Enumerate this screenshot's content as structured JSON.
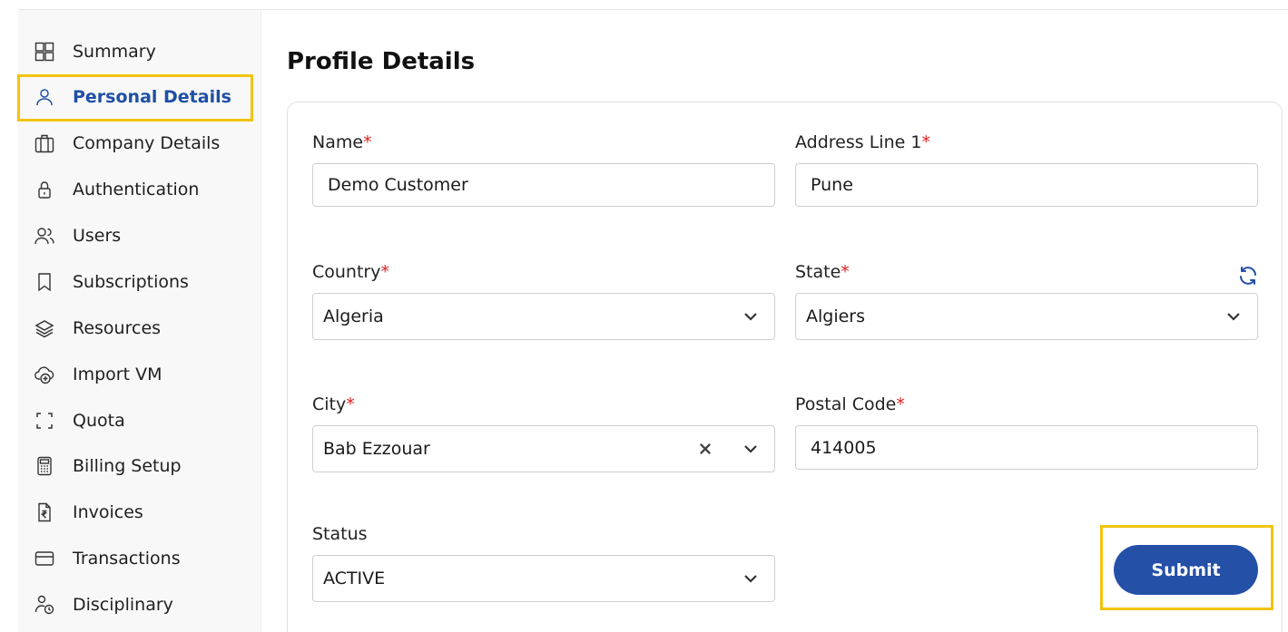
{
  "sidebar": {
    "items": [
      {
        "label": "Summary",
        "icon": "grid-icon"
      },
      {
        "label": "Personal Details",
        "icon": "user-icon",
        "active": true
      },
      {
        "label": "Company Details",
        "icon": "briefcase-icon"
      },
      {
        "label": "Authentication",
        "icon": "lock-icon"
      },
      {
        "label": "Users",
        "icon": "users-icon"
      },
      {
        "label": "Subscriptions",
        "icon": "bookmark-icon"
      },
      {
        "label": "Resources",
        "icon": "layers-icon"
      },
      {
        "label": "Import VM",
        "icon": "cloud-plus-icon"
      },
      {
        "label": "Quota",
        "icon": "frame-corners-icon"
      },
      {
        "label": "Billing Setup",
        "icon": "calculator-icon"
      },
      {
        "label": "Invoices",
        "icon": "rupee-document-icon"
      },
      {
        "label": "Transactions",
        "icon": "card-icon"
      },
      {
        "label": "Disciplinary",
        "icon": "user-clock-icon"
      }
    ]
  },
  "main": {
    "title": "Profile Details",
    "form": {
      "required_mark": "*",
      "name": {
        "label": "Name",
        "value": "Demo Customer"
      },
      "address_line_1": {
        "label": "Address Line 1",
        "value": "Pune"
      },
      "country": {
        "label": "Country",
        "value": "Algeria"
      },
      "state": {
        "label": "State",
        "value": "Algiers"
      },
      "city": {
        "label": "City",
        "value": "Bab Ezzouar"
      },
      "postal_code": {
        "label": "Postal Code",
        "value": "414005"
      },
      "status": {
        "label": "Status",
        "value": "ACTIVE"
      },
      "submit_label": "Submit"
    }
  },
  "colors": {
    "accent": "#2450a8",
    "active_text": "#1e4fa3",
    "required": "#e02020",
    "highlight": "#f2c40f",
    "sidebar_bg": "#f8f8f8"
  }
}
